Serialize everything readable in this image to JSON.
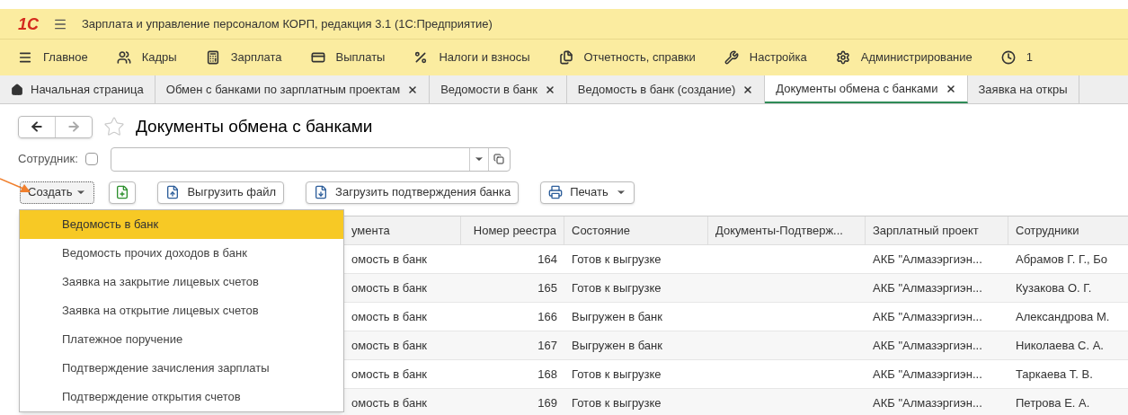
{
  "window": {
    "logo": "1С",
    "title": "Зарплата и управление персоналом КОРП, редакция 3.1  (1С:Предприятие)"
  },
  "sections": [
    {
      "kind": "menu",
      "label": "Главное"
    },
    {
      "kind": "people",
      "label": "Кадры"
    },
    {
      "kind": "calculator",
      "label": "Зарплата"
    },
    {
      "kind": "card",
      "label": "Выплаты"
    },
    {
      "kind": "percent",
      "label": "Налоги и взносы"
    },
    {
      "kind": "docs",
      "label": "Отчетность, справки"
    },
    {
      "kind": "wrench",
      "label": "Настройка"
    },
    {
      "kind": "gear",
      "label": "Администрирование"
    },
    {
      "kind": "clock",
      "label": "1"
    }
  ],
  "tabs": [
    {
      "kind": "home",
      "label": "Начальная страница",
      "selected": false
    },
    {
      "kind": "closable",
      "label": "Обмен с банками по зарплатным проектам",
      "selected": false
    },
    {
      "kind": "closable",
      "label": "Ведомости в банк",
      "selected": false
    },
    {
      "kind": "closable",
      "label": "Ведомость в банк (создание)",
      "selected": false
    },
    {
      "kind": "closable",
      "label": "Документы обмена с банками",
      "selected": true
    },
    {
      "kind": "plain",
      "label": "Заявка на откры",
      "selected": false
    }
  ],
  "page": {
    "title": "Документы обмена с банками",
    "favorite": false
  },
  "filter": {
    "label": "Сотрудник:",
    "checked": false
  },
  "toolbar": [
    {
      "kind": "dropdown",
      "label": "Создать"
    },
    {
      "kind": "add-icon"
    },
    {
      "kind": "upload",
      "label": "Выгрузить файл"
    },
    {
      "kind": "download",
      "label": "Загрузить подтверждения банка"
    },
    {
      "kind": "print",
      "label": "Печать"
    }
  ],
  "menu": [
    {
      "label": "Ведомость в банк",
      "selected": true
    },
    {
      "label": "Ведомость прочих доходов в банк",
      "selected": false
    },
    {
      "label": "Заявка на закрытие лицевых счетов",
      "selected": false
    },
    {
      "label": "Заявка на открытие лицевых счетов",
      "selected": false
    },
    {
      "label": "Платежное поручение",
      "selected": false
    },
    {
      "label": "Подтверждение зачисления зарплаты",
      "selected": false
    },
    {
      "label": "Подтверждение открытия счетов",
      "selected": false
    }
  ],
  "table": {
    "columns": [
      "умента",
      "Номер реестра",
      "Состояние",
      "Документы-Подтверж...",
      "Зарплатный проект",
      "Сотрудники"
    ],
    "rows": [
      [
        "омость в банк",
        "164",
        "Готов к выгрузке",
        "",
        "АКБ \"Алмазэргиэн...",
        "Абрамов Г. Г., Бо"
      ],
      [
        "омость в банк",
        "165",
        "Готов к выгрузке",
        "",
        "АКБ \"Алмазэргиэн...",
        "Кузакова О. Г."
      ],
      [
        "омость в банк",
        "166",
        "Выгружен в банк",
        "",
        "АКБ \"Алмазэргиэн...",
        "Александрова М."
      ],
      [
        "омость в банк",
        "167",
        "Выгружен в банк",
        "",
        "АКБ \"Алмазэргиэн...",
        "Николаева С. А."
      ],
      [
        "омость в банк",
        "168",
        "Готов к выгрузке",
        "",
        "АКБ \"Алмазэргиэн...",
        "Таркаева Т. В."
      ],
      [
        "омость в банк",
        "169",
        "Готов к выгрузке",
        "",
        "АКБ \"Алмазэргиэн...",
        "Петрова Е. А."
      ]
    ]
  }
}
